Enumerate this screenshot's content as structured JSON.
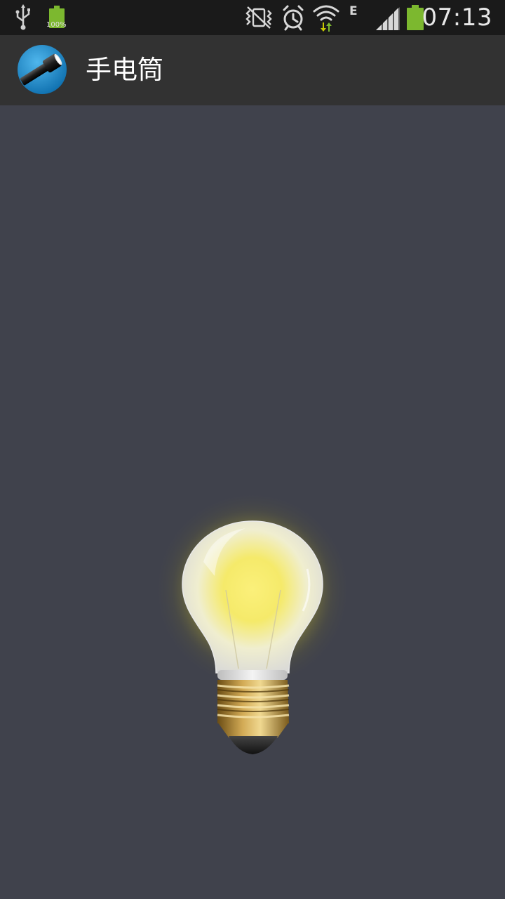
{
  "status_bar": {
    "battery_small_label": "100%",
    "network_type": "E",
    "time": "07:13",
    "icons": [
      "usb-icon",
      "battery-full-icon",
      "vibrate-icon",
      "alarm-icon",
      "wifi-icon",
      "network-e-icon",
      "signal-icon",
      "battery-icon"
    ],
    "accent_green": "#7cb82f"
  },
  "action_bar": {
    "title": "手电筒",
    "app_icon": "flashlight-icon"
  },
  "main": {
    "bulb_icon": "light-bulb-icon",
    "bulb_state": "on",
    "background_color": "#40424c"
  }
}
